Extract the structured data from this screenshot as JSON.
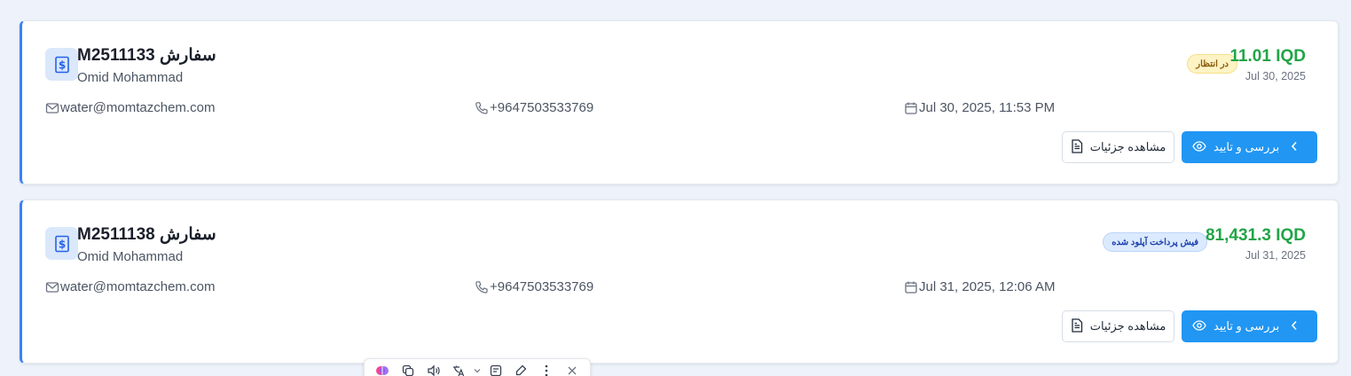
{
  "orders": [
    {
      "title": "M2511133 سفارش",
      "customer": "Omid Mohammad",
      "amount": "11.01 IQD",
      "date": "Jul 30, 2025",
      "status": "در انتظار",
      "email": "water@momtazchem.com",
      "phone": "+9647503533769",
      "datetime": "Jul 30, 2025, 11:53 PM",
      "details_label": "مشاهده جزئیات",
      "review_label": "بررسی و تایید"
    },
    {
      "title": "M2511138 سفارش",
      "customer": "Omid Mohammad",
      "amount": "81,431.3 IQD",
      "date": "Jul 31, 2025",
      "status": "فیش پرداخت آپلود شده",
      "email": "water@momtazchem.com",
      "phone": "+9647503533769",
      "datetime": "Jul 31, 2025, 12:06 AM",
      "details_label": "مشاهده جزئیات",
      "review_label": "بررسی و تایید"
    }
  ],
  "colors": {
    "accent_border": "#3b82f6",
    "amount": "#22a447",
    "primary_button": "#2196f3",
    "pending_badge_bg": "#fdf3c4",
    "uploaded_badge_bg": "#dbeafe"
  },
  "icons": {
    "order": "dollar-document-icon",
    "email": "mail-icon",
    "phone": "phone-icon",
    "datetime": "calendar-icon",
    "details": "file-text-icon",
    "review": "eye-icon",
    "review_arrow": "chevron-left-icon"
  },
  "toolbar_icons": [
    "brain-icon",
    "copy-icon",
    "speaker-icon",
    "translate-icon",
    "chevron-down-icon",
    "note-icon",
    "highlight-icon",
    "more-icon",
    "close-icon"
  ]
}
